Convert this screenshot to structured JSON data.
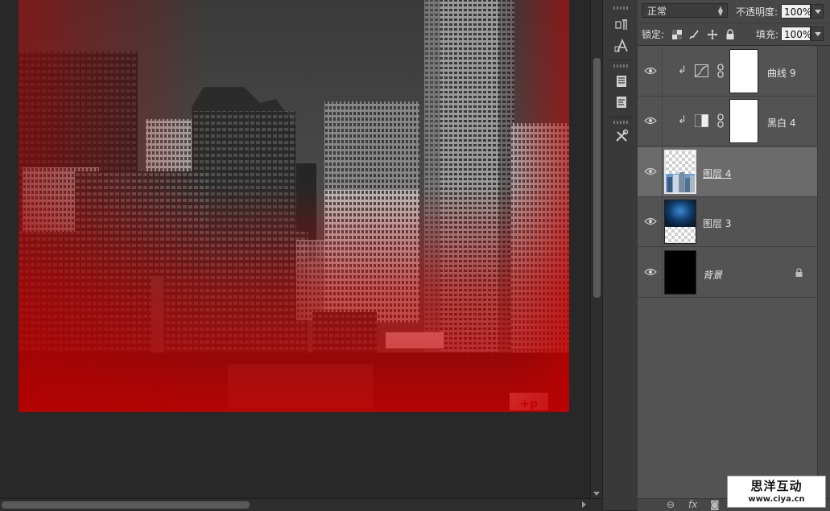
{
  "layers_panel": {
    "blend_mode": "正常",
    "opacity_label": "不透明度:",
    "opacity_value": "100%",
    "lock_label": "锁定:",
    "fill_label": "填充:",
    "fill_value": "100%",
    "layers": [
      {
        "name": "曲线 9",
        "type": "curves-adjustment",
        "clipped": true,
        "visible": true,
        "selected": false
      },
      {
        "name": "黑白 4",
        "type": "black-white-adjustment",
        "clipped": true,
        "visible": true,
        "selected": false
      },
      {
        "name": "图层 4",
        "type": "pixel-layer-city",
        "clipped": false,
        "visible": true,
        "selected": true
      },
      {
        "name": "图层 3",
        "type": "pixel-layer-blue-texture",
        "clipped": false,
        "visible": true,
        "selected": false
      },
      {
        "name": "背景",
        "type": "background",
        "clipped": false,
        "visible": true,
        "selected": false,
        "locked": true
      }
    ],
    "bottom_icons": [
      "link-icon",
      "fx-icon",
      "mask-icon"
    ],
    "bottom_fx": "fx"
  },
  "tool_strip": {
    "icons": [
      "paragraph-icon",
      "character-icon",
      "notes-icon",
      "history-icon",
      "tools-preset-icon"
    ]
  },
  "canvas": {
    "image": "grayscale city skyline with red gradient overlay",
    "billboard_text": "+p"
  },
  "watermark": {
    "title": "思洋互动",
    "url": "www.ciya.cn"
  },
  "colors": {
    "panel_bg": "#535353",
    "selected_layer": "#6b6b6b",
    "canvas_bg": "#282828",
    "red_overlay": "#d00000"
  }
}
